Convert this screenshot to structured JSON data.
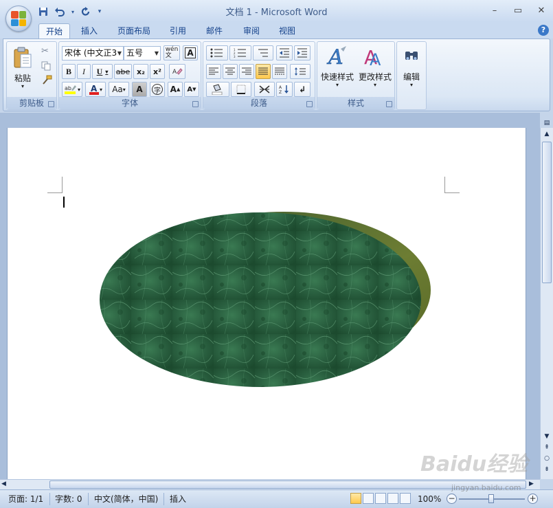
{
  "window": {
    "title": "文档 1 - Microsoft Word"
  },
  "tabs": [
    "开始",
    "插入",
    "页面布局",
    "引用",
    "邮件",
    "审阅",
    "视图"
  ],
  "ribbon": {
    "clipboard": {
      "paste_label": "粘贴",
      "group_label": "剪贴板"
    },
    "font": {
      "font_name": "宋体 (中文正3",
      "font_size": "五号",
      "group_label": "字体",
      "buttons": {
        "bold": "B",
        "italic": "I",
        "underline": "U",
        "strike": "abe",
        "subscript": "x₂",
        "superscript": "x²",
        "grow": "A",
        "shrink": "A",
        "case": "Aa",
        "char_shading": "A",
        "enclose": "字",
        "phonetic": "wén\n文"
      }
    },
    "paragraph": {
      "group_label": "段落"
    },
    "styles": {
      "quick_styles_label": "快速样式",
      "change_styles_label": "更改样式",
      "group_label": "样式"
    },
    "editing": {
      "label": "编辑"
    }
  },
  "status_bar": {
    "page": "页面: 1/1",
    "words": "字数: 0",
    "language": "中文(简体，中国)",
    "insert_mode": "插入",
    "zoom": "100%"
  },
  "colors": {
    "accent": "#15428b",
    "ellipse_green": "#2c6a44",
    "shadow_olive": "#6b7a2c"
  },
  "watermark": {
    "logo": "Baidu经验",
    "url": "jingyan.baidu.com"
  }
}
